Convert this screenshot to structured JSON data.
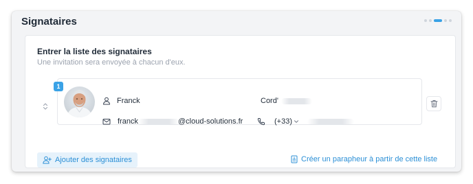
{
  "panel": {
    "title": "Signataires",
    "stepper": {
      "total": 5,
      "active_index": 2
    }
  },
  "card": {
    "title": "Entrer la liste des signataires",
    "subtitle": "Une invitation sera envoyée à chacun d'eux."
  },
  "signer": {
    "order": "1",
    "first_name": "Franck",
    "last_name": "Cord'",
    "email_prefix": "franck",
    "email_domain": "@cloud-solutions.fr",
    "phone_prefix": "(+33)"
  },
  "actions": {
    "add_label": "Ajouter des signataires",
    "create_parapheur_label": "Créer un parapheur à partir de cette liste"
  },
  "colors": {
    "accent": "#3aa2e6",
    "link": "#2b8fd6",
    "add_button_bg": "#e6f2fb"
  },
  "icons": [
    "drag-handle-icon",
    "user-icon",
    "mail-icon",
    "phone-icon",
    "chevron-down-icon",
    "trash-icon",
    "user-plus-icon",
    "document-icon"
  ]
}
